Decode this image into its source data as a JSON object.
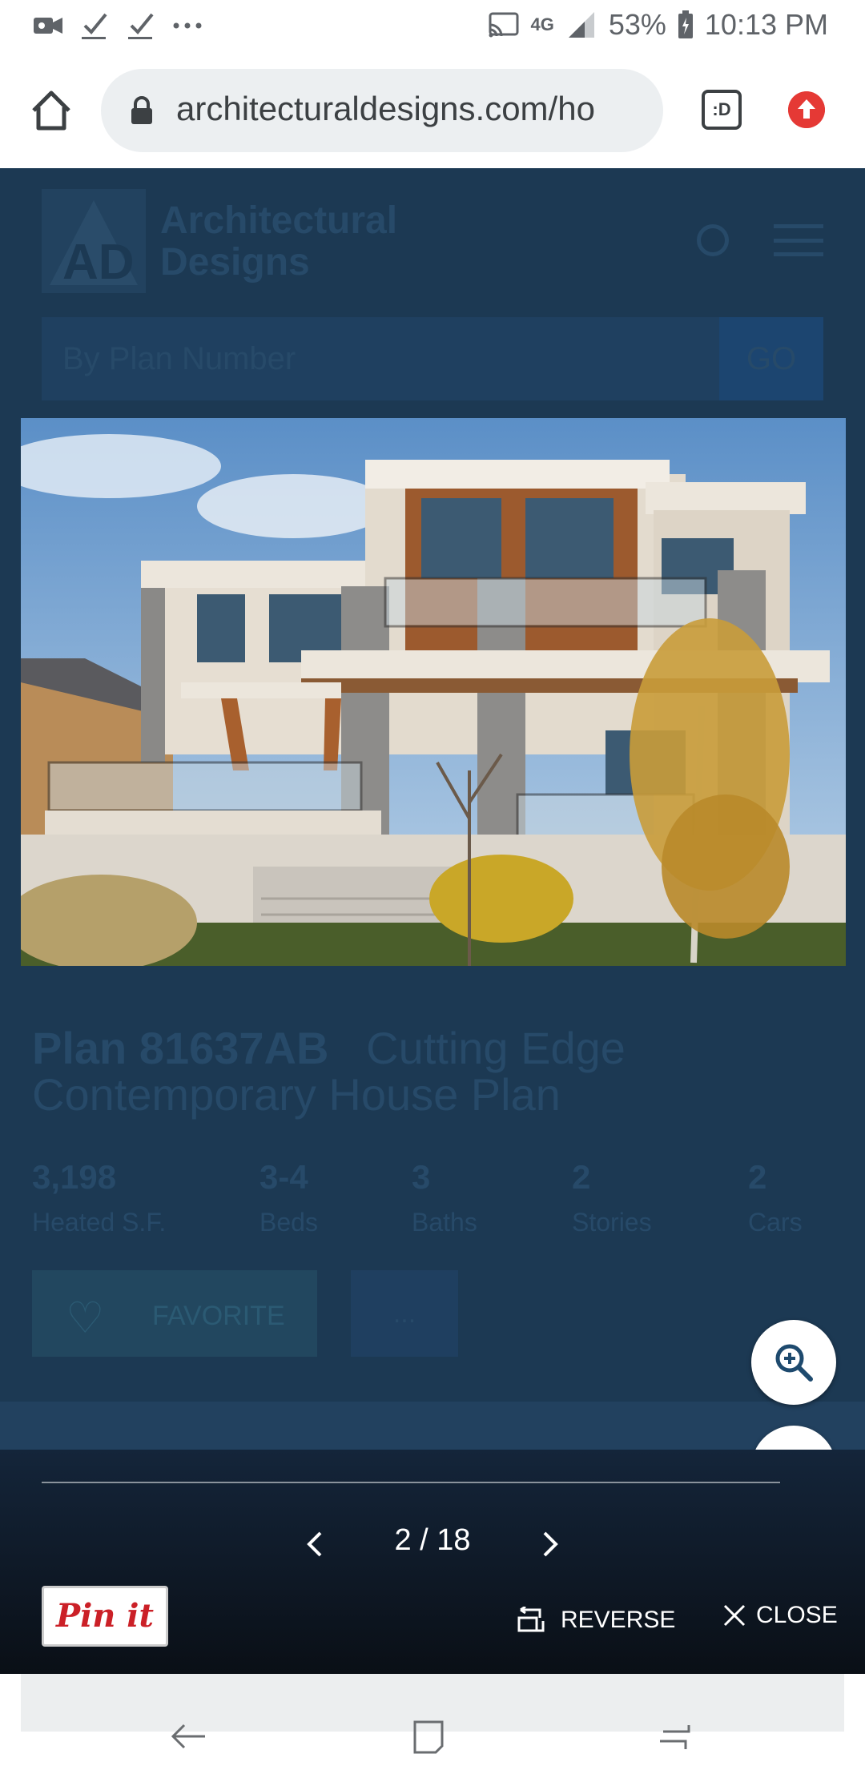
{
  "status_bar": {
    "time": "10:13 PM",
    "battery": "53%",
    "network": "4G",
    "icons": [
      "video-icon",
      "check-icon",
      "check-icon",
      "more-dots-icon",
      "cast-icon",
      "signal-icon",
      "battery-icon"
    ]
  },
  "browser": {
    "url": "architecturaldesigns.com/ho",
    "tab_label": ":D"
  },
  "site": {
    "logo_line1": "Architectural",
    "logo_line2": "Designs",
    "logo_mark": "AD",
    "search_placeholder": "By Plan Number",
    "go_label": "GO"
  },
  "plan": {
    "number": "Plan 81637AB",
    "name_part1": "Cutting Edge",
    "name_part2": "Contemporary House Plan",
    "stats": [
      {
        "value": "3,198",
        "label": "Heated S.F."
      },
      {
        "value": "3-4",
        "label": "Beds"
      },
      {
        "value": "3",
        "label": "Baths"
      },
      {
        "value": "2",
        "label": "Stories"
      },
      {
        "value": "2",
        "label": "Cars"
      }
    ],
    "favorite_label": "FAVORITE",
    "more_label": "..."
  },
  "gallery": {
    "counter": "2 / 18",
    "pin_label": "Pin it",
    "reverse_label": "REVERSE",
    "close_label": "CLOSE"
  }
}
